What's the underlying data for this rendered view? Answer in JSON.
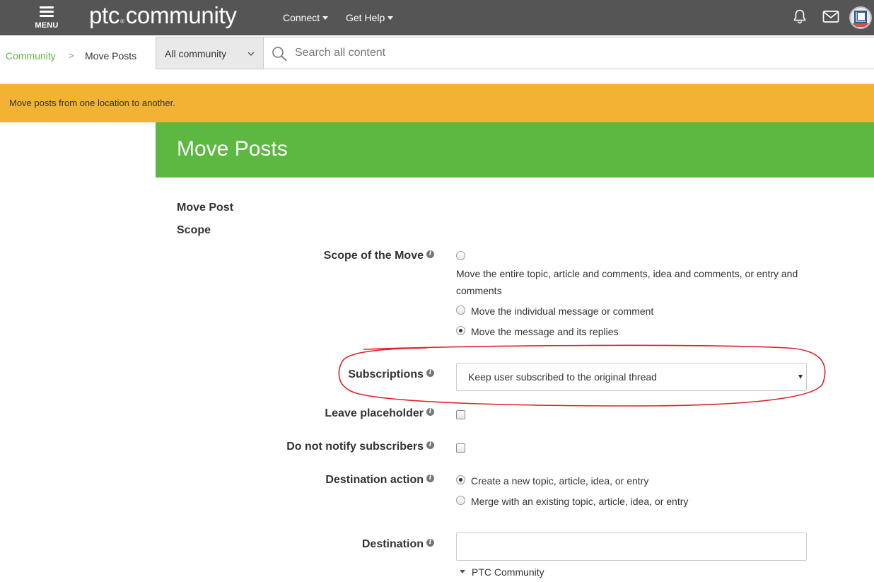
{
  "topbar": {
    "menu_label": "MENU",
    "logo_brand": "ptc",
    "logo_mark": "®",
    "logo_word": "community",
    "nav": [
      {
        "label": "Connect"
      },
      {
        "label": "Get Help"
      }
    ],
    "icons": [
      "bell-icon",
      "mail-icon",
      "avatar"
    ]
  },
  "breadcrumb": {
    "home": "Community",
    "separator": ">",
    "current": "Move Posts"
  },
  "search": {
    "scope_value": "All community",
    "placeholder": "Search all content"
  },
  "notice": {
    "text": "Move posts from one location to another."
  },
  "page": {
    "title": "Move Posts"
  },
  "sections": {
    "move_post": "Move Post",
    "scope": "Scope"
  },
  "form": {
    "scope_of_move": {
      "label": "Scope of the Move",
      "options": [
        {
          "text": "Move the entire topic, article and comments, idea and comments, or entry and comments",
          "selected": false
        },
        {
          "text": "Move the individual message or comment",
          "selected": false
        },
        {
          "text": "Move the message and its replies",
          "selected": true
        }
      ]
    },
    "subscriptions": {
      "label": "Subscriptions",
      "value": "Keep user subscribed to the original thread"
    },
    "leave_placeholder": {
      "label": "Leave placeholder",
      "checked": false
    },
    "do_not_notify": {
      "label": "Do not notify subscribers",
      "checked": false
    },
    "destination_action": {
      "label": "Destination action",
      "options": [
        {
          "text": "Create a new topic, article, idea, or entry",
          "selected": true
        },
        {
          "text": "Merge with an existing topic, article, idea, or entry",
          "selected": false
        }
      ]
    },
    "destination": {
      "label": "Destination",
      "value": "",
      "tree_root": "PTC Community"
    }
  },
  "colors": {
    "topbar": "#555555",
    "accent_green": "#5cb840",
    "notice_orange": "#f2b234",
    "annotation_red": "#e0202a"
  }
}
